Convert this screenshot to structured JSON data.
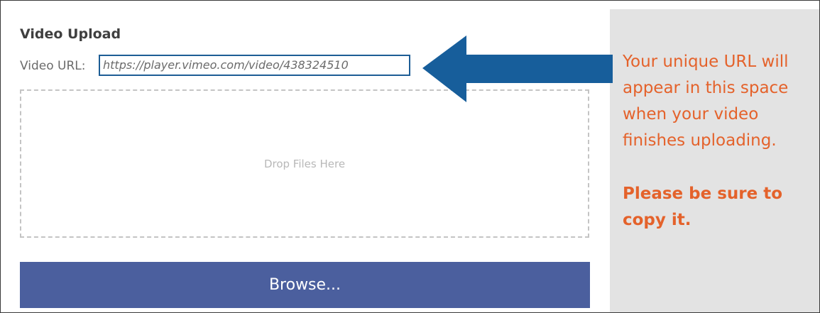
{
  "upload": {
    "title": "Video Upload",
    "url_label": "Video URL:",
    "url_value": "https://player.vimeo.com/video/438324510",
    "dropzone_text": "Drop Files Here",
    "browse_label": "Browse..."
  },
  "callout": {
    "message": "Your unique URL will appear in this space when your video finishes uploading.",
    "note": "Please be sure to copy it."
  },
  "colors": {
    "arrow": "#175e9b",
    "callout_text": "#e4622b",
    "button": "#4b5f9e",
    "side_panel": "#e3e3e3"
  },
  "icons": {
    "arrow": "left-arrow-icon"
  }
}
